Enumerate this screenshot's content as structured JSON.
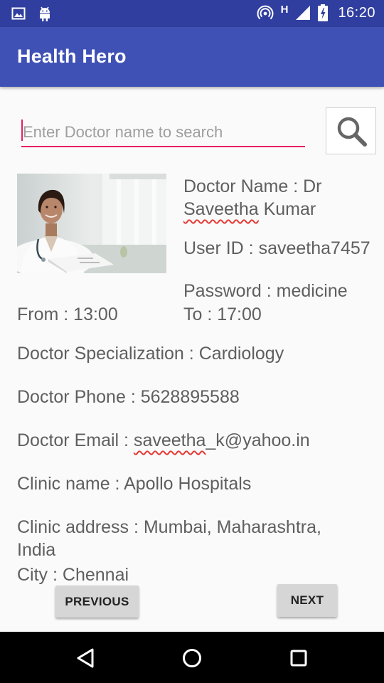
{
  "status_bar": {
    "time": "16:20",
    "network_type": "H",
    "icons": [
      "image-icon",
      "android-icon",
      "hotspot-icon",
      "signal-icon",
      "battery-icon"
    ]
  },
  "app_bar": {
    "title": "Health Hero"
  },
  "search": {
    "placeholder": "Enter Doctor name to search",
    "value": ""
  },
  "doctor": {
    "name_label": "Doctor Name :",
    "name_prefix": "Dr",
    "first_name": "Saveetha",
    "last_name": "Kumar",
    "user_id_label": "User ID :",
    "user_id": "saveetha7457",
    "password_label": "Password :",
    "password": "medicine",
    "from_label": "From :",
    "from_time": "13:00",
    "to_label": "To :",
    "to_time": "17:00",
    "specialization_label": "Doctor Specialization :",
    "specialization": "Cardiology",
    "phone_label": "Doctor Phone :",
    "phone": "5628895588",
    "email_label": "Doctor Email :",
    "email_user": "saveetha",
    "email_rest": "_k@yahoo.in",
    "clinic_name_label": "Clinic name :",
    "clinic_name": "Apollo Hospitals",
    "clinic_address_label": "Clinic address :",
    "clinic_address_line1": "Mumbai, Maharashtra,",
    "clinic_address_line2": "India",
    "city_label": "City :",
    "city": "Chennai"
  },
  "buttons": {
    "previous": "PREVIOUS",
    "next": "NEXT"
  },
  "colors": {
    "primary": "#3F51B5",
    "primary_dark": "#303F9F",
    "accent": "#E91E63"
  }
}
